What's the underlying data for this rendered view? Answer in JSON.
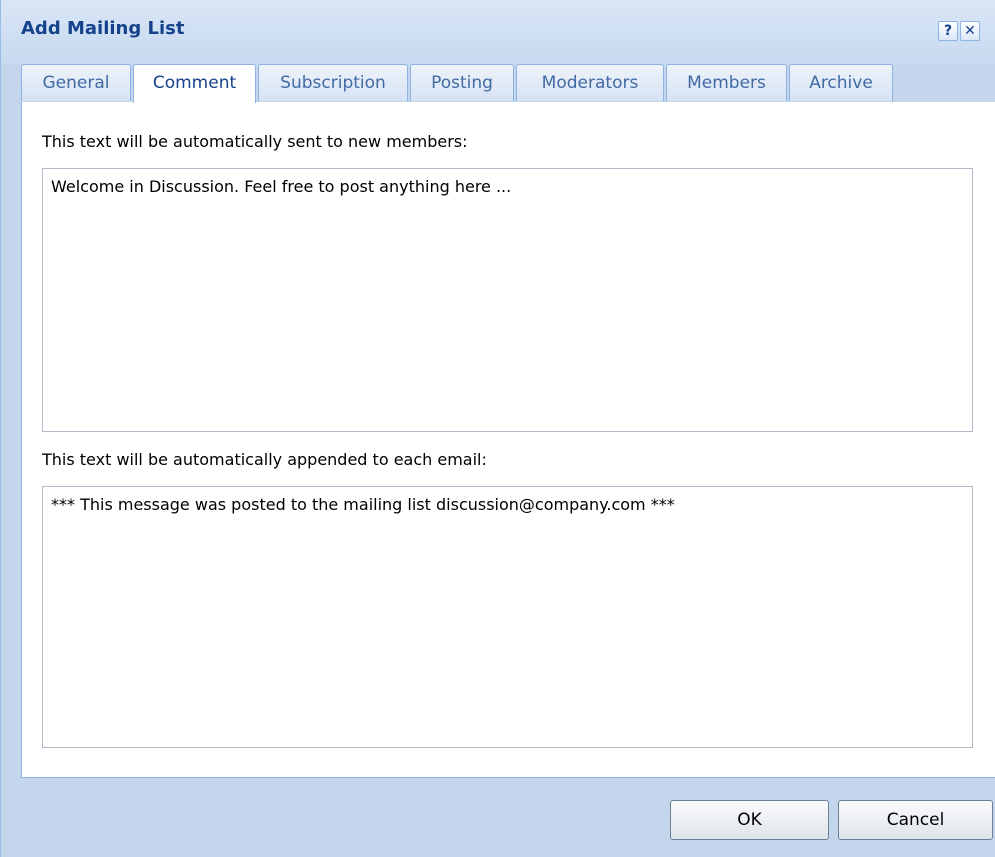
{
  "dialog": {
    "title": "Add Mailing List",
    "help_label": "?",
    "close_label": "✕"
  },
  "tabs": [
    {
      "label": "General",
      "active": false
    },
    {
      "label": "Comment",
      "active": true
    },
    {
      "label": "Subscription",
      "active": false
    },
    {
      "label": "Posting",
      "active": false
    },
    {
      "label": "Moderators",
      "active": false
    },
    {
      "label": "Members",
      "active": false
    },
    {
      "label": "Archive",
      "active": false
    }
  ],
  "comment": {
    "welcome_label": "This text will be automatically sent to new members:",
    "welcome_value": "Welcome in Discussion. Feel free to post anything here ...",
    "footer_label": "This text will be automatically appended to each email:",
    "footer_value": "*** This message was posted to the mailing list discussion@company.com ***"
  },
  "buttons": {
    "ok": "OK",
    "cancel": "Cancel"
  },
  "colors": {
    "title_text": "#15428b",
    "window_frame": "#c4d6ec",
    "tab_border": "#8db2e3"
  }
}
